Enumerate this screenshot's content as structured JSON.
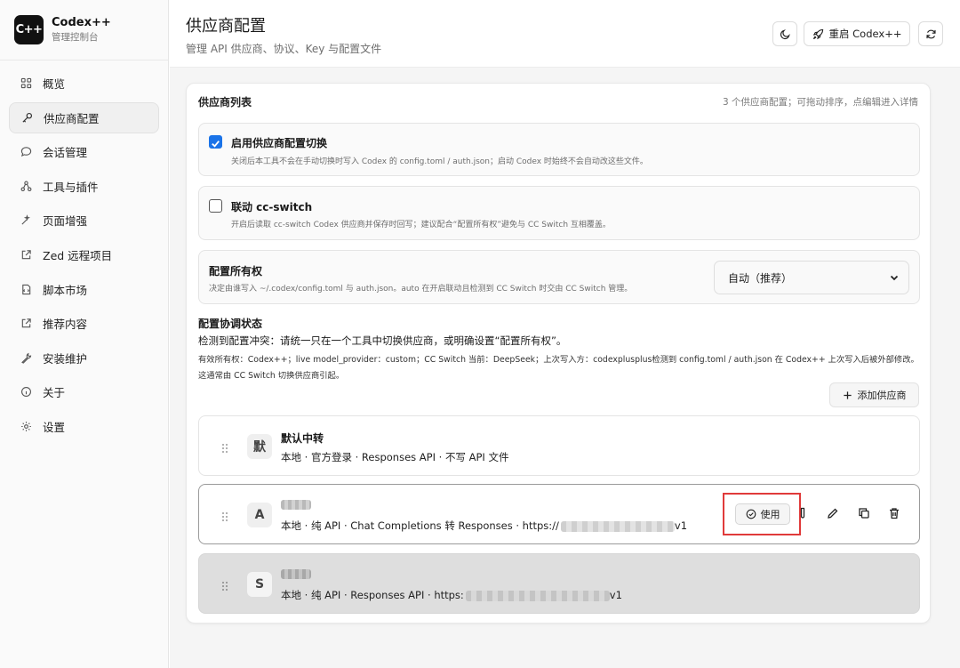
{
  "app": {
    "logo": "C++",
    "name": "Codex++",
    "subtitle": "管理控制台"
  },
  "sidebar": {
    "items": [
      {
        "label": "概览",
        "icon": "grid-icon"
      },
      {
        "label": "供应商配置",
        "icon": "key-icon",
        "active": true
      },
      {
        "label": "会话管理",
        "icon": "chat-icon"
      },
      {
        "label": "工具与插件",
        "icon": "plugin-icon"
      },
      {
        "label": "页面增强",
        "icon": "wand-icon"
      },
      {
        "label": "Zed 远程项目",
        "icon": "external-link-icon"
      },
      {
        "label": "脚本市场",
        "icon": "script-icon"
      },
      {
        "label": "推荐内容",
        "icon": "external-link-icon"
      },
      {
        "label": "安装维护",
        "icon": "wrench-icon"
      },
      {
        "label": "关于",
        "icon": "info-icon"
      },
      {
        "label": "设置",
        "icon": "gear-icon"
      }
    ]
  },
  "header": {
    "title": "供应商配置",
    "subtitle": "管理 API 供应商、协议、Key 与配置文件",
    "restart_label": "重启 Codex++"
  },
  "card": {
    "title": "供应商列表",
    "hint": "3 个供应商配置；可拖动排序，点编辑进入详情"
  },
  "options": {
    "switch": {
      "title": "启用供应商配置切换",
      "desc": "关闭后本工具不会在手动切换时写入 Codex 的 config.toml / auth.json；启动 Codex 时始终不会自动改这些文件。",
      "checked": true
    },
    "ccswitch": {
      "title": "联动 cc-switch",
      "desc": "开启后读取 cc-switch Codex 供应商并保存时回写；建议配合“配置所有权”避免与 CC Switch 互相覆盖。",
      "checked": false
    },
    "ownership": {
      "title": "配置所有权",
      "desc": "决定由谁写入 ~/.codex/config.toml 与 auth.json。auto 在开启联动且检测到 CC Switch 时交由 CC Switch 管理。",
      "selected": "自动（推荐）"
    }
  },
  "sync": {
    "title": "配置协调状态",
    "warning": "检测到配置冲突：请统一只在一个工具中切换供应商，或明确设置“配置所有权”。",
    "detail": "有效所有权：Codex++；live model_provider：custom；CC Switch 当前：DeepSeek；上次写入方：codexplusplus检测到 config.toml / auth.json 在 Codex++ 上次写入后被外部修改。这通常由 CC Switch 切换供应商引起。"
  },
  "add_provider_label": "添加供应商",
  "providers": [
    {
      "avatar": "默",
      "name": "默认中转",
      "desc": "本地 · 官方登录 · Responses API · 不写 API 文件"
    },
    {
      "avatar": "A",
      "desc_prefix": "本地 · 纯 API · Chat Completions 转 Responses · https://",
      "desc_suffix": "v1",
      "use_label": "使用"
    },
    {
      "avatar": "S",
      "desc_prefix": "本地 · 纯 API · Responses API · https:",
      "desc_suffix": "v1"
    }
  ],
  "colors": {
    "checkbox": "#1a73e8",
    "highlight": "#e03a3a"
  }
}
